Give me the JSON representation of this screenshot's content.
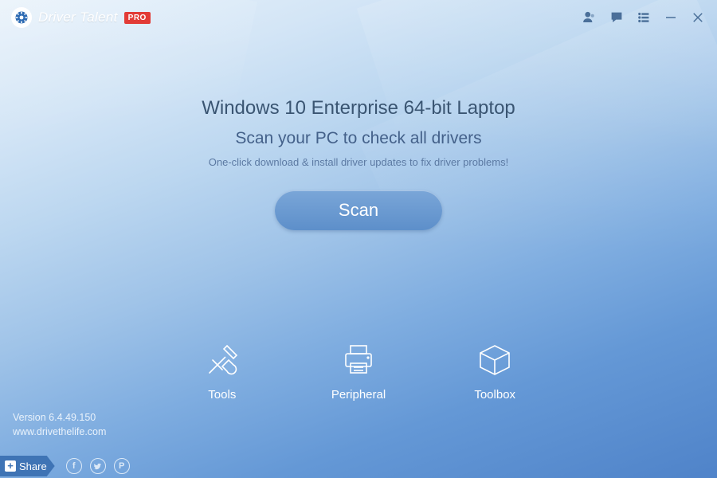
{
  "brand": {
    "name": "Driver Talent",
    "badge": "PRO"
  },
  "top_icons": {
    "user": "user-icon",
    "feedback": "speech-icon",
    "settings": "list-icon",
    "minimize": "minimize-icon",
    "close": "close-icon"
  },
  "hero": {
    "system_line": "Windows 10 Enterprise 64-bit Laptop",
    "prompt_line": "Scan your PC to check all drivers",
    "sub_line": "One-click download & install driver updates to fix driver problems!",
    "scan_label": "Scan"
  },
  "tools": [
    {
      "id": "tools",
      "label": "Tools"
    },
    {
      "id": "peripheral",
      "label": "Peripheral"
    },
    {
      "id": "toolbox",
      "label": "Toolbox"
    }
  ],
  "footer": {
    "version": "Version 6.4.49.150",
    "site": "www.drivethelife.com",
    "share_label": "Share"
  },
  "colors": {
    "accent": "#3f74b5",
    "badge": "#e23b36"
  }
}
